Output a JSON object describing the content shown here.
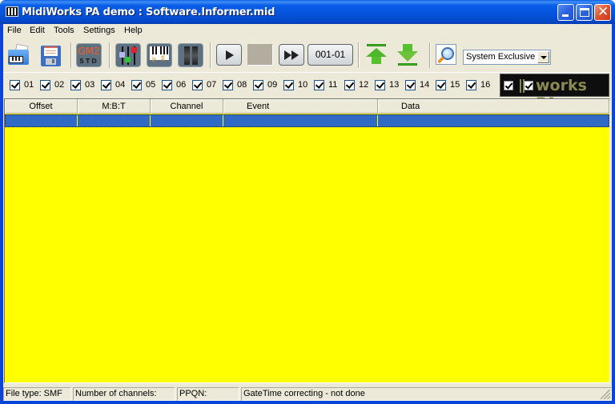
{
  "window": {
    "title": "MidiWorks PA demo : Software.Informer.mid",
    "controls": [
      "minimize",
      "maximize",
      "close"
    ]
  },
  "menu": [
    "File",
    "Edit",
    "Tools",
    "Settings",
    "Help"
  ],
  "toolbar": {
    "icons": [
      "open-midi-icon",
      "save-icon",
      "gm2-std-icon",
      "mixer-icon",
      "piano-accidentals-icon",
      "slots-icon"
    ],
    "gm2_top": "GM2",
    "gm2_bottom": "STD",
    "accidentals": [
      "♭",
      "♯"
    ],
    "transport": {
      "position": "001-01"
    },
    "event_filter": {
      "selected": "System Exclusive"
    }
  },
  "channels": [
    {
      "label": "01",
      "checked": true
    },
    {
      "label": "02",
      "checked": true
    },
    {
      "label": "03",
      "checked": true
    },
    {
      "label": "04",
      "checked": true
    },
    {
      "label": "05",
      "checked": true
    },
    {
      "label": "06",
      "checked": true
    },
    {
      "label": "07",
      "checked": true
    },
    {
      "label": "08",
      "checked": true
    },
    {
      "label": "09",
      "checked": true
    },
    {
      "label": "10",
      "checked": true
    },
    {
      "label": "11",
      "checked": true
    },
    {
      "label": "12",
      "checked": true
    },
    {
      "label": "13",
      "checked": true
    },
    {
      "label": "14",
      "checked": true
    },
    {
      "label": "15",
      "checked": true
    },
    {
      "label": "16",
      "checked": true
    }
  ],
  "logo": {
    "text": "works PA"
  },
  "table": {
    "columns": [
      "Offset",
      "M:B:T",
      "Channel",
      "Event",
      "Data"
    ],
    "rows": [
      {
        "Offset": "",
        "M:B:T": "",
        "Channel": "",
        "Event": "",
        "Data": "",
        "selected": true
      }
    ]
  },
  "status": {
    "file_type": "File type: SMF",
    "channels": "Number of channels:",
    "ppqn": "PPQN:",
    "gatetime": "GateTime correcting - not done"
  },
  "colors": {
    "grid_background": "#ffff00",
    "selection": "#316ac5",
    "titlebar": "#0453d9",
    "logo_text": "#8a8a50"
  }
}
